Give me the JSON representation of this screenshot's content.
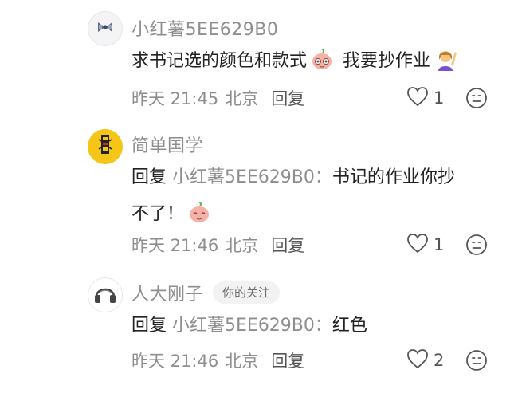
{
  "comments": [
    {
      "author": "小红薯5EE629B0",
      "text": "求书记选的颜色和款式",
      "text_after": "我要抄作业",
      "time": "昨天 21:45",
      "location": "北京",
      "reply_label": "回复",
      "likes": "1",
      "avatar_icon": "bow-icon",
      "sticker_icon": "peach-face-sticker-icon",
      "emoji_icon": "woman-raising-hand-icon"
    },
    {
      "author": "简单国学",
      "reply_prefix": "回复",
      "reply_target": "小红薯5EE629B0：",
      "text": "书记的作业你抄",
      "text_line2": "不了！",
      "time": "昨天 21:46",
      "location": "北京",
      "reply_label": "回复",
      "likes": "1",
      "avatar_icon": "seal-logo-icon",
      "sticker_icon": "peach-face-sticker-icon"
    },
    {
      "author": "人大刚子",
      "tag": "你的关注",
      "reply_prefix": "回复",
      "reply_target": "小红薯5EE629B0：",
      "text": "红色",
      "time": "昨天 21:46",
      "location": "北京",
      "reply_label": "回复",
      "likes": "2",
      "avatar_icon": "headphones-icon"
    }
  ],
  "colors": {
    "secondary_text": "#8e8e8e",
    "primary_text": "#222222",
    "avatar2_bg": "#f5c518"
  }
}
